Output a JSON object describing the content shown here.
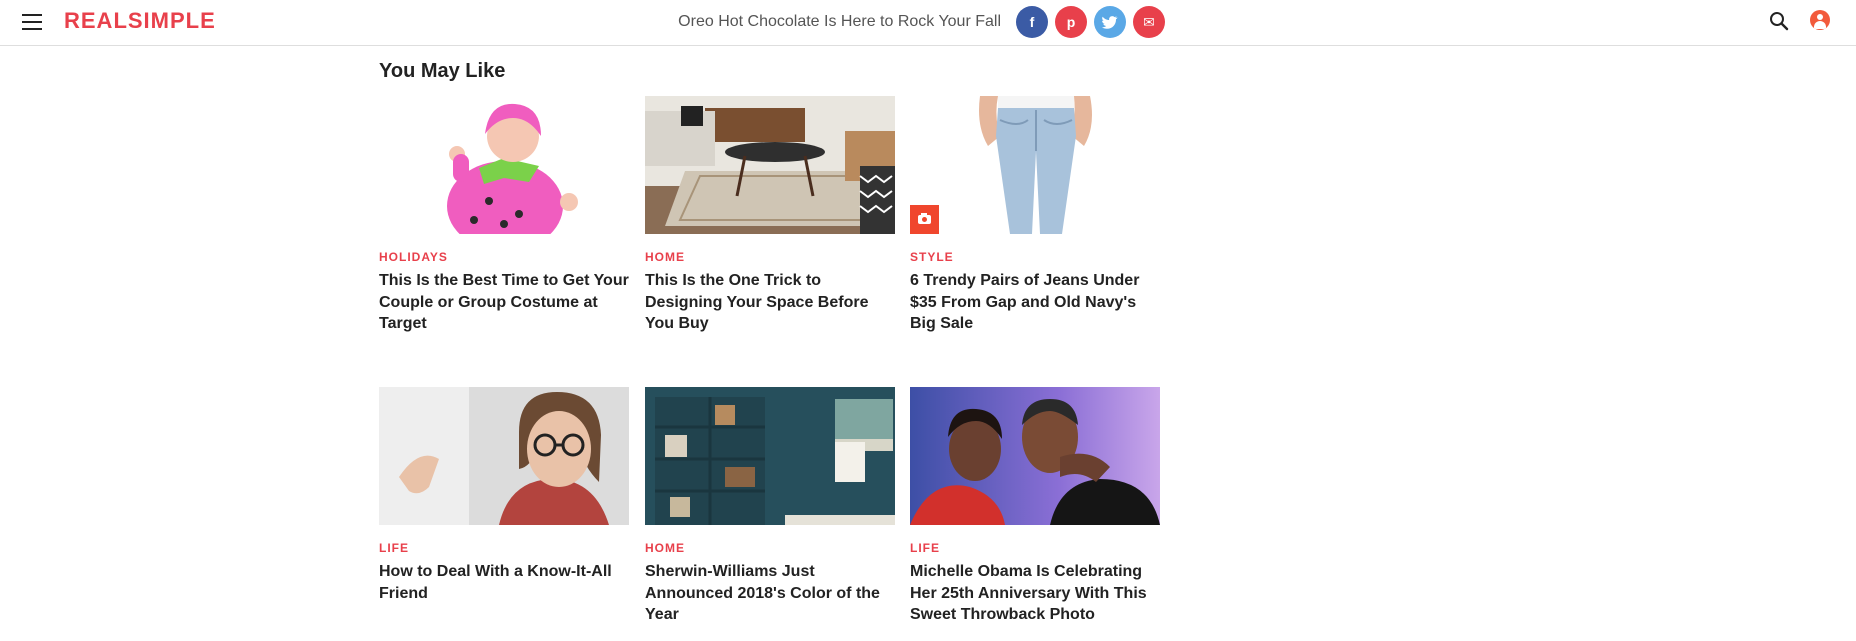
{
  "header": {
    "logo": "REALSIMPLE",
    "headline": "Oreo Hot Chocolate Is Here to Rock Your Fall",
    "share": {
      "facebook": "f",
      "pinterest": "p",
      "twitter": "t",
      "email": "✉"
    },
    "icons": [
      "menu-icon",
      "search-icon",
      "user-icon"
    ]
  },
  "section": {
    "title": "You May Like"
  },
  "cards": [
    {
      "category": "HOLIDAYS",
      "title": "This Is the Best Time to Get Your Couple or Group Costume at Target",
      "image": "baby-strawberry-costume"
    },
    {
      "category": "HOME",
      "title": "This Is the One Trick to Designing Your Space Before You Buy",
      "image": "living-room-rug"
    },
    {
      "category": "STYLE",
      "title": "6 Trendy Pairs of Jeans Under $35 From Gap and Old Navy's Big Sale",
      "image": "jeans",
      "badge": "camera-icon"
    },
    {
      "category": "LIFE",
      "title": "How to Deal With a Know-It-All Friend",
      "image": "woman-glasses"
    },
    {
      "category": "HOME",
      "title": "Sherwin-Williams Just Announced 2018's Color of the Year",
      "image": "teal-bookshelf-room"
    },
    {
      "category": "LIFE",
      "title": "Michelle Obama Is Celebrating Her 25th Anniversary With This Sweet Throwback Photo",
      "image": "couple-dancing"
    }
  ],
  "colors": {
    "accent": "#e8404b",
    "facebook": "#3b5ba5",
    "twitter": "#5aa8e6",
    "badge": "#f0462d"
  }
}
